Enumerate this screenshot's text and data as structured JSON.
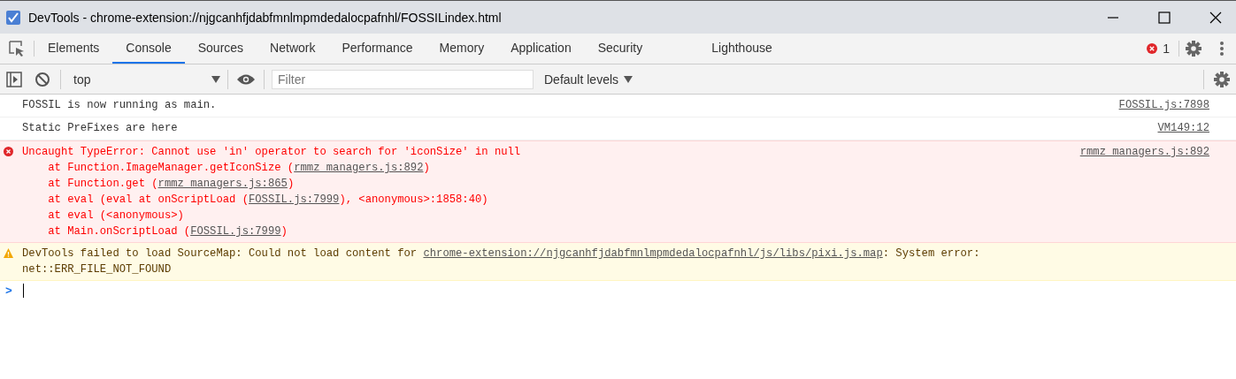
{
  "window": {
    "title": "DevTools - chrome-extension://njgcanhfjdabfmnlmpmdedalocpafnhl/FOSSILindex.html"
  },
  "tabs": [
    {
      "label": "Elements",
      "selected": false
    },
    {
      "label": "Console",
      "selected": true
    },
    {
      "label": "Sources",
      "selected": false
    },
    {
      "label": "Network",
      "selected": false
    },
    {
      "label": "Performance",
      "selected": false
    },
    {
      "label": "Memory",
      "selected": false
    },
    {
      "label": "Application",
      "selected": false
    },
    {
      "label": "Security",
      "selected": false
    },
    {
      "label": "Lighthouse",
      "selected": false
    }
  ],
  "error_count": "1",
  "toolbar": {
    "context": "top",
    "filter": {
      "placeholder": "Filter"
    },
    "levels": "Default levels"
  },
  "messages": [
    {
      "kind": "log",
      "source": "FOSSIL.js:7898",
      "lines": [
        [
          {
            "text": "FOSSIL is now running as main.",
            "link": false
          }
        ]
      ]
    },
    {
      "kind": "log",
      "source": "VM149:12",
      "lines": [
        [
          {
            "text": "Static PreFixes are here",
            "link": false
          }
        ]
      ]
    },
    {
      "kind": "error",
      "source": "rmmz_managers.js:892",
      "lines": [
        [
          {
            "text": "Uncaught TypeError: Cannot use 'in' operator to search for 'iconSize' in null",
            "link": false
          }
        ],
        [
          {
            "text": "    at Function.ImageManager.getIconSize (",
            "link": false
          },
          {
            "text": "rmmz_managers.js:892",
            "link": true
          },
          {
            "text": ")",
            "link": false
          }
        ],
        [
          {
            "text": "    at Function.get (",
            "link": false
          },
          {
            "text": "rmmz_managers.js:865",
            "link": true
          },
          {
            "text": ")",
            "link": false
          }
        ],
        [
          {
            "text": "    at eval (eval at onScriptLoad (",
            "link": false
          },
          {
            "text": "FOSSIL.js:7999",
            "link": true
          },
          {
            "text": "), <anonymous>:1858:40)",
            "link": false
          }
        ],
        [
          {
            "text": "    at eval (<anonymous>)",
            "link": false
          }
        ],
        [
          {
            "text": "    at Main.onScriptLoad (",
            "link": false
          },
          {
            "text": "FOSSIL.js:7999",
            "link": true
          },
          {
            "text": ")",
            "link": false
          }
        ]
      ]
    },
    {
      "kind": "warning",
      "lines": [
        [
          {
            "text": "DevTools failed to load SourceMap: Could not load content for ",
            "link": false
          },
          {
            "text": "chrome-extension://njgcanhfjdabfmnlmpmdedalocpafnhl/js/libs/pixi.js.map",
            "link": true
          },
          {
            "text": ": System error:",
            "link": false
          }
        ],
        [
          {
            "text": "net::ERR_FILE_NOT_FOUND",
            "link": false
          }
        ]
      ]
    }
  ],
  "prompt": ">"
}
